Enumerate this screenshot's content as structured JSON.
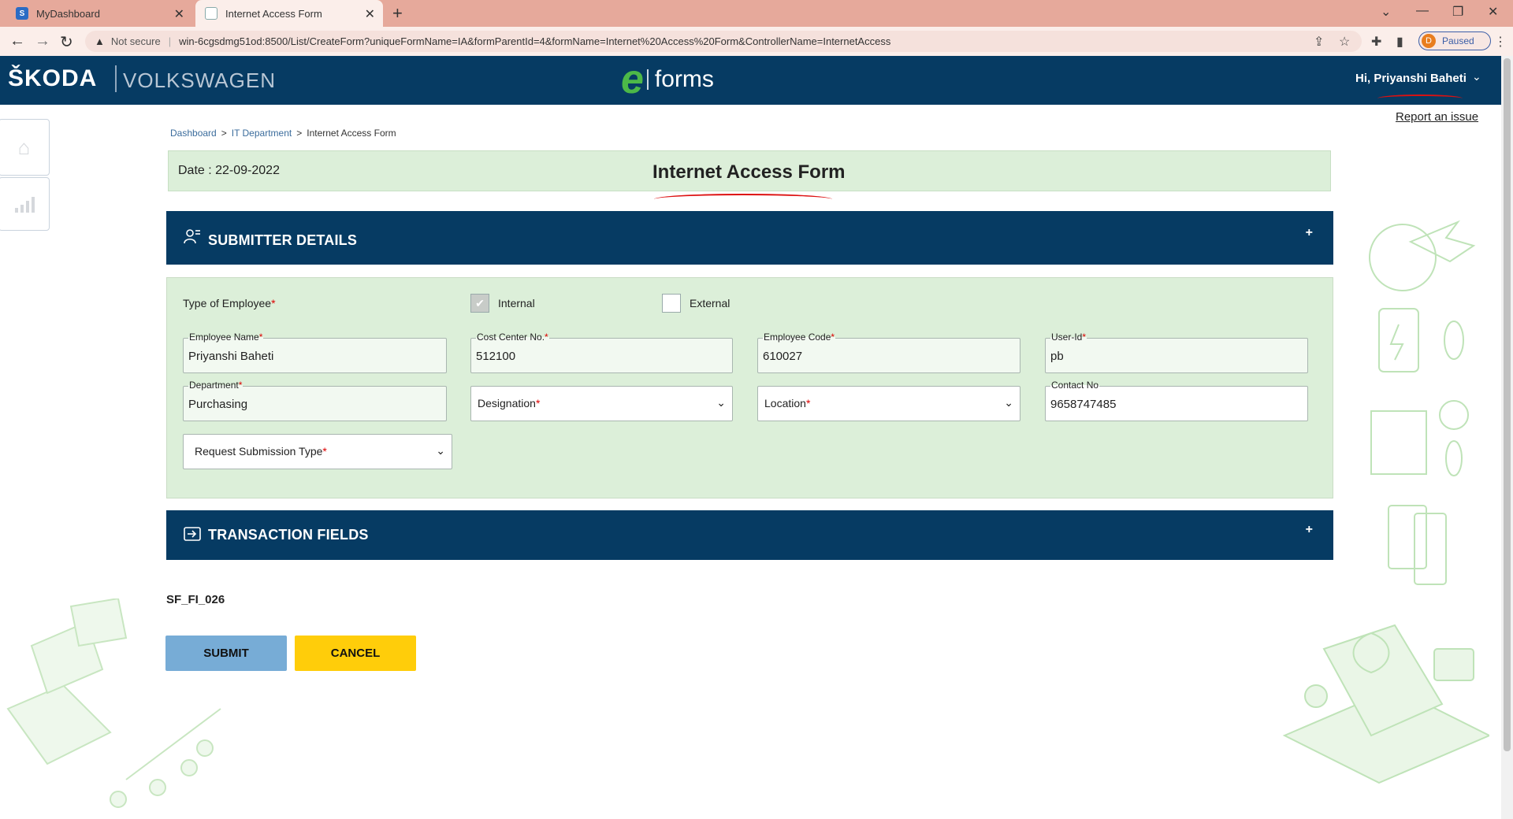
{
  "browser": {
    "tabs": [
      {
        "title": "MyDashboard",
        "active": false
      },
      {
        "title": "Internet Access Form",
        "active": true
      }
    ],
    "address": {
      "security": "Not secure",
      "url": "win-6cgsdmg51od:8500/List/CreateForm?uniqueFormName=IA&formParentId=4&formName=Internet%20Access%20Form&ControllerName=InternetAccess"
    },
    "profile_status": "Paused",
    "profile_initial": "D"
  },
  "header": {
    "brand_left": "ŠKODA",
    "brand_right": "VOLKSWAGEN",
    "app_e": "e",
    "app_name": "forms",
    "greeting": "Hi, Priyanshi Baheti"
  },
  "report_link": "Report an issue",
  "breadcrumb": {
    "items": [
      "Dashboard",
      "IT Department",
      "Internet Access Form"
    ],
    "separator": ">"
  },
  "form": {
    "date": "Date : 22-09-2022",
    "title": "Internet Access Form",
    "sections": {
      "submitter": "SUBMITTER DETAILS",
      "transaction": "TRANSACTION FIELDS"
    },
    "employee_type": {
      "label": "Type of Employee",
      "options": [
        {
          "label": "Internal",
          "checked": true
        },
        {
          "label": "External",
          "checked": false
        }
      ]
    },
    "fields": {
      "employee_name": {
        "label": "Employee Name",
        "value": "Priyanshi Baheti"
      },
      "cost_center": {
        "label": "Cost Center No.",
        "value": "512100"
      },
      "employee_code": {
        "label": "Employee Code",
        "value": "610027"
      },
      "user_id": {
        "label": "User-Id",
        "value": "pb"
      },
      "department": {
        "label": "Department",
        "value": "Purchasing"
      },
      "designation": {
        "placeholder": "Designation"
      },
      "location": {
        "placeholder": "Location"
      },
      "contact_no": {
        "label": "Contact No",
        "value": "9658747485"
      },
      "request_type": {
        "placeholder": "Request Submission Type"
      }
    },
    "required_mark": "*",
    "form_code": "SF_FI_026",
    "buttons": {
      "submit": "SUBMIT",
      "cancel": "CANCEL"
    }
  },
  "colors": {
    "header_bg": "#063b63",
    "form_bg": "#dcefd9",
    "submit_bg": "#77acd6",
    "cancel_bg": "#ffcd0a",
    "tabbar_bg": "#e6a99b"
  }
}
